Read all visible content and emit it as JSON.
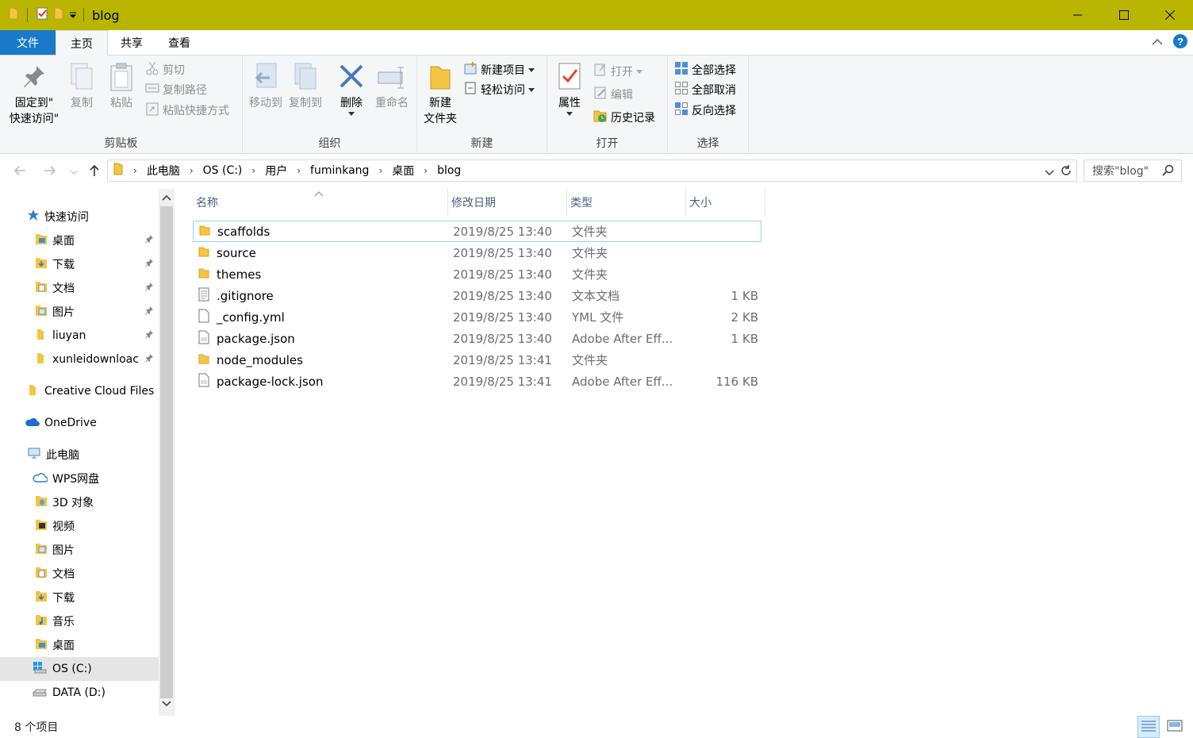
{
  "window": {
    "title": "blog"
  },
  "tabs": {
    "file": "文件",
    "home": "主页",
    "share": "共享",
    "view": "查看"
  },
  "ribbon": {
    "clipboard": {
      "label": "剪贴板",
      "pin_line1": "固定到\"",
      "pin_line2": "快速访问\"",
      "copy": "复制",
      "paste": "粘贴",
      "cut": "剪切",
      "copy_path": "复制路径",
      "paste_shortcut": "粘贴快捷方式"
    },
    "organize": {
      "label": "组织",
      "move_to": "移动到",
      "copy_to": "复制到",
      "delete": "删除",
      "rename": "重命名"
    },
    "new": {
      "label": "新建",
      "new_folder_line1": "新建",
      "new_folder_line2": "文件夹",
      "new_item": "新建项目",
      "easy_access": "轻松访问"
    },
    "open": {
      "label": "打开",
      "properties": "属性",
      "open": "打开",
      "edit": "编辑",
      "history": "历史记录"
    },
    "select": {
      "label": "选择",
      "select_all": "全部选择",
      "select_none": "全部取消",
      "invert": "反向选择"
    }
  },
  "address": {
    "crumbs": [
      "此电脑",
      "OS (C:)",
      "用户",
      "fuminkang",
      "桌面",
      "blog"
    ],
    "search_placeholder": "搜索\"blog\""
  },
  "nav": {
    "quick_access": "快速访问",
    "quick_items": [
      "桌面",
      "下载",
      "文档",
      "图片",
      "liuyan",
      "xunleidownloac"
    ],
    "creative_cloud": "Creative Cloud Files",
    "onedrive": "OneDrive",
    "this_pc": "此电脑",
    "pc_items": [
      "WPS网盘",
      "3D 对象",
      "视频",
      "图片",
      "文档",
      "下载",
      "音乐",
      "桌面"
    ],
    "os_drive": "OS (C:)",
    "data_drive": "DATA (D:)"
  },
  "columns": {
    "name": "名称",
    "date": "修改日期",
    "type": "类型",
    "size": "大小"
  },
  "files": [
    {
      "name": "scaffolds",
      "date": "2019/8/25 13:40",
      "type": "文件夹",
      "size": "",
      "icon": "folder"
    },
    {
      "name": "source",
      "date": "2019/8/25 13:40",
      "type": "文件夹",
      "size": "",
      "icon": "folder"
    },
    {
      "name": "themes",
      "date": "2019/8/25 13:40",
      "type": "文件夹",
      "size": "",
      "icon": "folder"
    },
    {
      "name": ".gitignore",
      "date": "2019/8/25 13:40",
      "type": "文本文档",
      "size": "1 KB",
      "icon": "text"
    },
    {
      "name": "_config.yml",
      "date": "2019/8/25 13:40",
      "type": "YML 文件",
      "size": "2 KB",
      "icon": "blank"
    },
    {
      "name": "package.json",
      "date": "2019/8/25 13:40",
      "type": "Adobe After Eff...",
      "size": "1 KB",
      "icon": "json"
    },
    {
      "name": "node_modules",
      "date": "2019/8/25 13:41",
      "type": "文件夹",
      "size": "",
      "icon": "folder"
    },
    {
      "name": "package-lock.json",
      "date": "2019/8/25 13:41",
      "type": "Adobe After Eff...",
      "size": "116 KB",
      "icon": "json"
    }
  ],
  "status": {
    "count": "8 个项目"
  }
}
